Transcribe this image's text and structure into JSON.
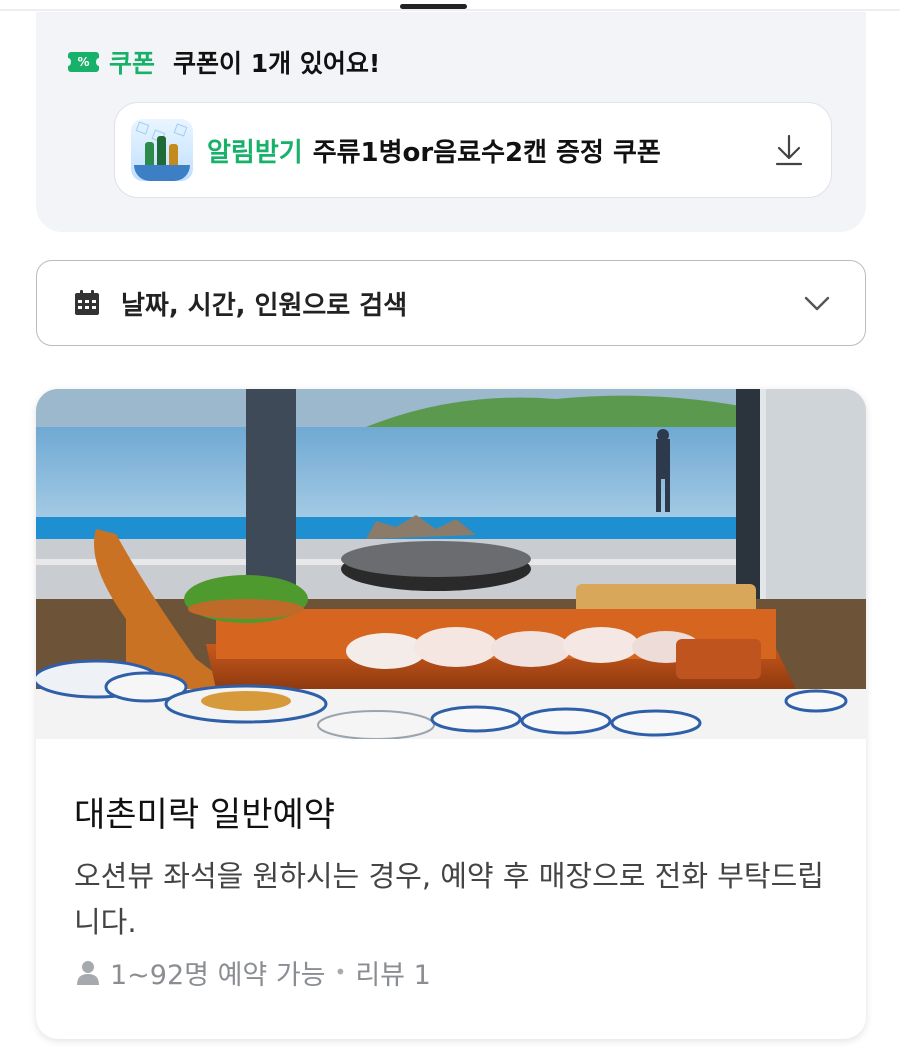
{
  "coupon": {
    "icon": "coupon-tag-icon",
    "icon_glyph": "%",
    "title": "쿠폰",
    "count_text": "쿠폰이 1개 있어요!",
    "item": {
      "alert_label": "알림받기",
      "description": "주류1병or음료수2캔 증정 쿠폰",
      "thumbnail": "drinks-on-ice-thumbnail",
      "action_icon": "download-icon"
    }
  },
  "search": {
    "icon": "calendar-icon",
    "label": "날짜, 시간, 인원으로 검색",
    "chevron": "chevron-down-icon"
  },
  "booking": {
    "image": "ocean-view-sashimi-boat-photo",
    "title": "대촌미락 일반예약",
    "description": "오션뷰 좌석을 원하시는 경우, 예약 후 매장으로 전화 부탁드립니다.",
    "capacity": "1~92명 예약 가능",
    "separator": "•",
    "reviews": "리뷰 1"
  },
  "colors": {
    "accent_green": "#17b169",
    "panel_bg": "#f2f4f7"
  }
}
